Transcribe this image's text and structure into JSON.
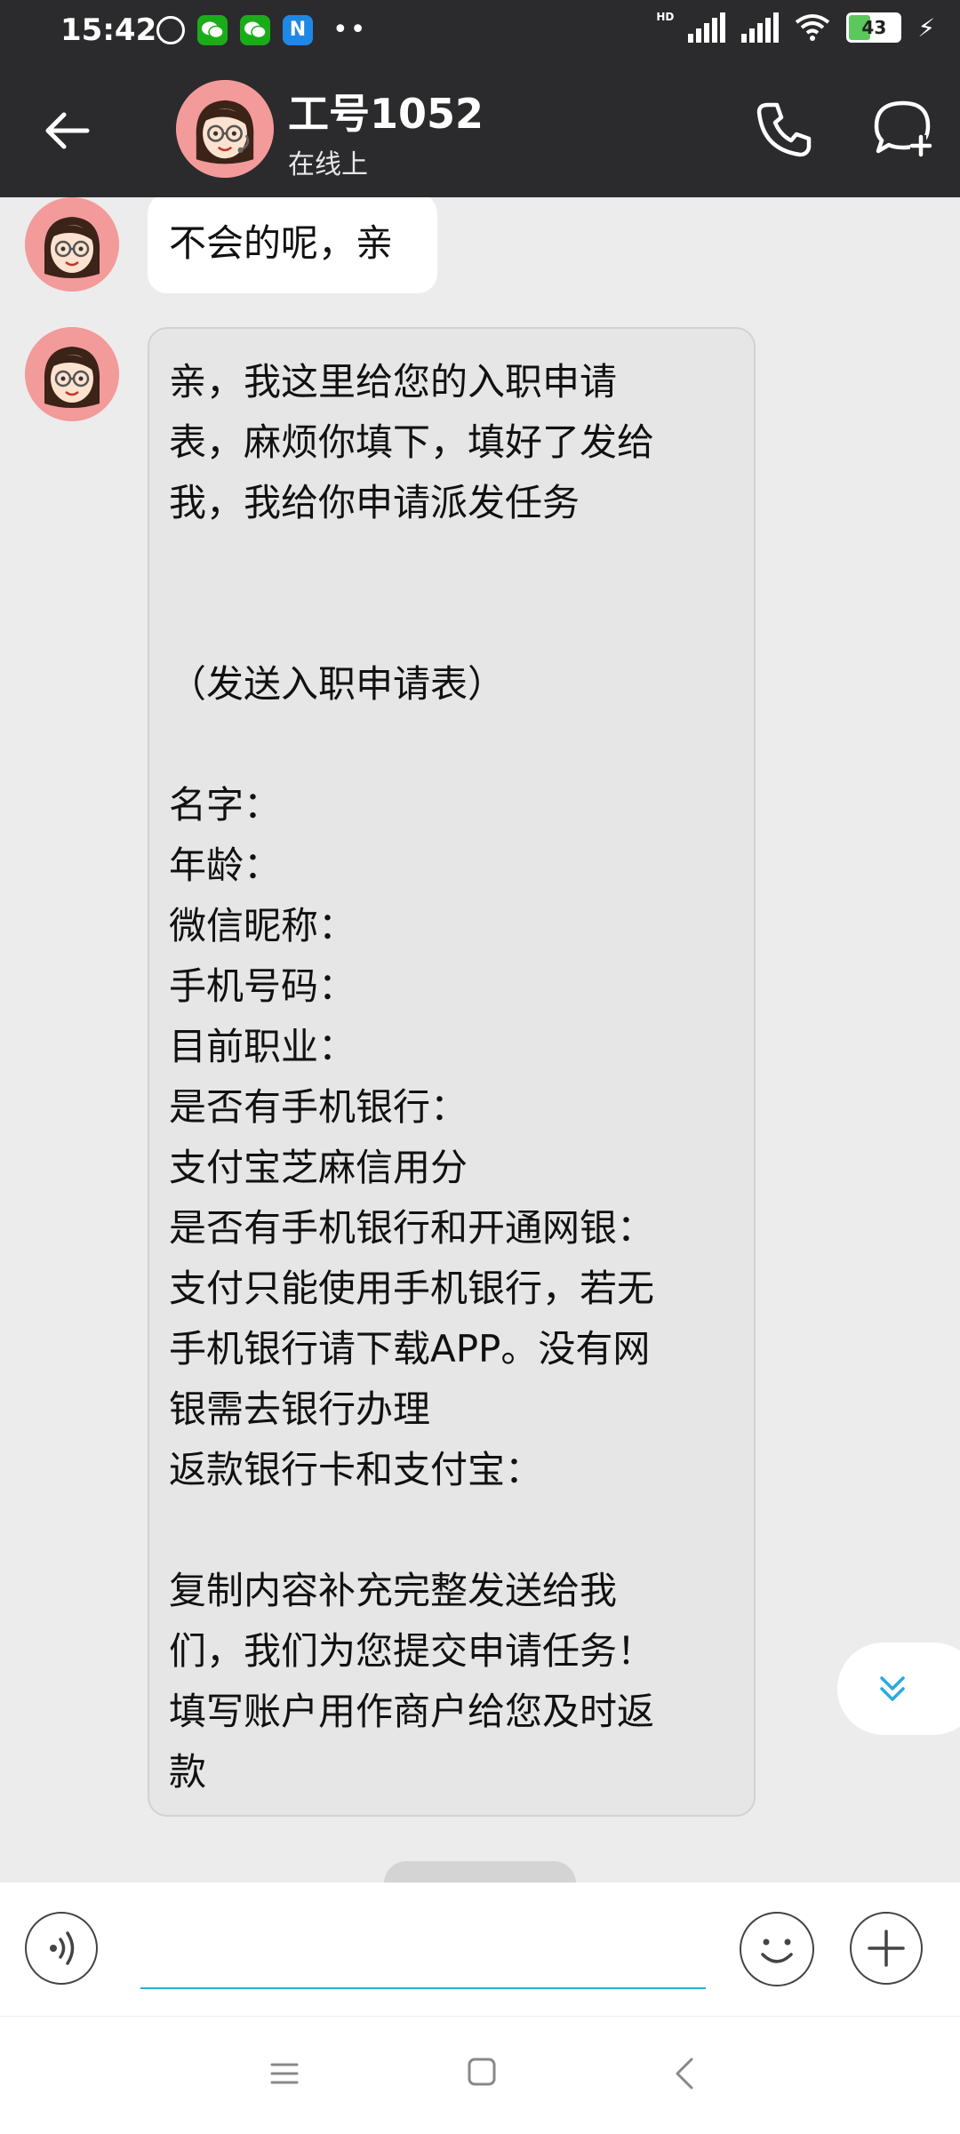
{
  "status_bar": {
    "time": "15:42",
    "battery": "43",
    "hd_label": "HD"
  },
  "header": {
    "name": "工号1052",
    "status": "在线上"
  },
  "messages": [
    {
      "text": "不会的呢，亲",
      "style": "white"
    },
    {
      "text": "亲，我这里给您的入职申请\n表，麻烦你填下，填好了发给\n我，我给你申请派发任务\n\n\n（发送入职申请表）\n\n名字：\n年龄：\n微信昵称：\n手机号码：\n目前职业：\n是否有手机银行：\n支付宝芝麻信用分\n是否有手机银行和开通网银：\n支付只能使用手机银行，若无\n手机银行请下载APP。没有网\n银需去银行办理\n返款银行卡和支付宝：\n\n复制内容补充完整发送给我\n们，我们为您提交申请任务！\n填写账户用作商户给您及时返\n款",
      "style": "gray"
    }
  ],
  "input": {
    "placeholder": ""
  },
  "colors": {
    "header_bg": "#2b2b2d",
    "chat_bg": "#ececec",
    "accent": "#2aa9e0",
    "avatar_bg": "#f39a9a"
  },
  "icons": {
    "back": "arrow-left-icon",
    "call": "phone-icon",
    "chat_add": "chat-plus-icon",
    "voice": "voice-icon",
    "emoji": "smile-icon",
    "add": "plus-icon",
    "scroll_down": "double-chevron-down-icon"
  }
}
